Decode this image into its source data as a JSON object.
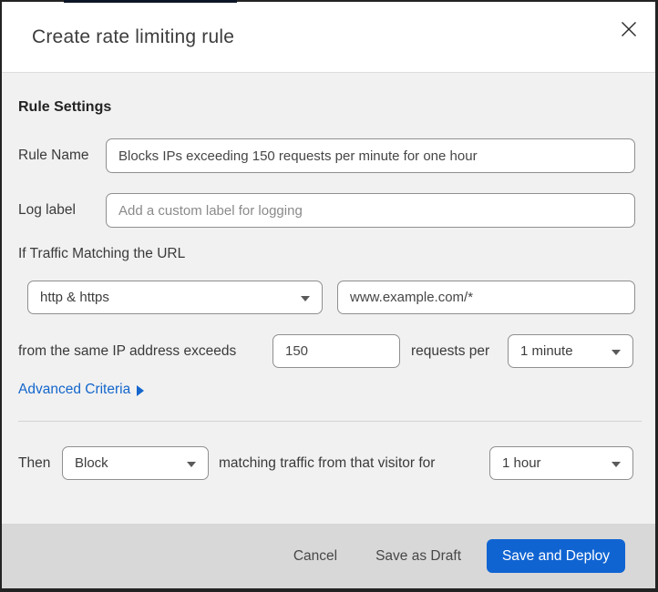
{
  "dialog": {
    "title": "Create rate limiting rule"
  },
  "form": {
    "section_title": "Rule Settings",
    "rule_name": {
      "label": "Rule Name",
      "value": "Blocks IPs exceeding 150 requests per minute for one hour"
    },
    "log_label": {
      "label": "Log label",
      "placeholder": "Add a custom label for logging"
    },
    "match": {
      "intro": "If Traffic Matching the URL",
      "scheme_selected": "http & https",
      "url_value": "www.example.com/*"
    },
    "rate": {
      "prefix": "from the same IP address exceeds",
      "threshold_value": "150",
      "middle": "requests per",
      "period_selected": "1 minute"
    },
    "advanced_link": "Advanced Criteria",
    "action": {
      "prefix": "Then",
      "action_selected": "Block",
      "middle": "matching traffic from that visitor for",
      "duration_selected": "1 hour"
    }
  },
  "footer": {
    "cancel": "Cancel",
    "save_draft": "Save as Draft",
    "save_deploy": "Save and Deploy"
  },
  "colors": {
    "primary_button_blue": "#1064d2",
    "link_blue": "#1466cc",
    "body_background": "#f1f1f1",
    "footer_background": "#d8d8d8",
    "window_border": "#232323"
  }
}
